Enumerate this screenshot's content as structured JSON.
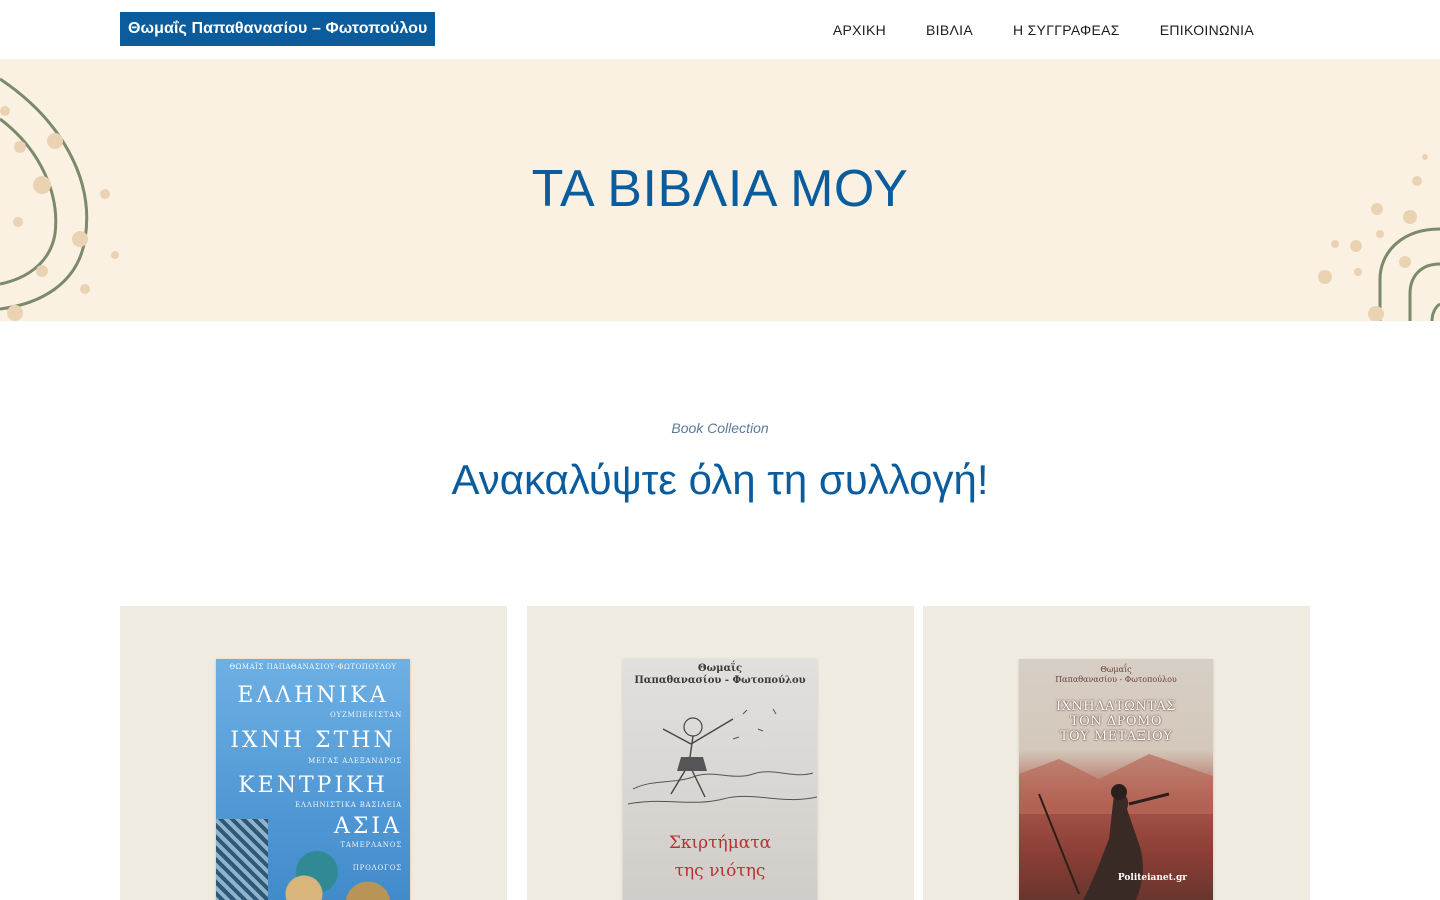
{
  "header": {
    "logo_text": "Θωμαΐς Παπαθανασίου – Φωτοπούλου",
    "nav": [
      {
        "label": "ΑΡΧΙΚΗ"
      },
      {
        "label": "ΒΙΒΛΙΑ"
      },
      {
        "label": "Η ΣΥΓΓΡΑΦΕΑΣ"
      },
      {
        "label": "ΕΠΙΚΟΙΝΩΝΙΑ"
      }
    ]
  },
  "hero": {
    "title": "ΤΑ ΒΙΒΛΙΑ ΜΟΥ"
  },
  "intro": {
    "tag": "Book Collection",
    "heading": "Ανακαλύψτε όλη τη συλλογή!"
  },
  "books": [
    {
      "cover_author": "ΘΩΜΑΪΣ ΠΑΠΑΘΑΝΑΣΙΟΥ-ΦΩΤΟΠΟΥΛΟΥ",
      "title_lines": [
        "ΕΛΛΗΝΙΚΑ",
        "ΙΧΝΗ ΣΤΗΝ",
        "ΚΕΝΤΡΙΚΗ",
        "ΑΣΙΑ"
      ],
      "subtitles": [
        "ΟΥΖΜΠΕΚΙΣΤΑΝ",
        "ΜΕΓΑΣ ΑΛΕΞΑΝΔΡΟΣ",
        "ΕΛΛΗΝΙΣΤΙΚΑ ΒΑΣΙΛΕΙΑ",
        "ΤΑΜΕΡΛΑΝΟΣ"
      ],
      "foreword": "ΠΡΟΛΟΓΟΣ"
    },
    {
      "cover_author": [
        "Θωμαΐς",
        "Παπαθανασίου - Φωτοπούλου"
      ],
      "title_lines": [
        "Σκιρτήματα",
        "της νιότης"
      ]
    },
    {
      "cover_author": [
        "Θωμαΐς",
        "Παπαθανασίου - Φωτοπούλου"
      ],
      "title_lines": [
        "ΙΧΝΗΛΑΤΩΝΤΑΣ",
        "ΤΟΝ ΔΡΟΜΟ",
        "ΤΟΥ ΜΕΤΑΞΙΟΥ"
      ],
      "publisher": "Politeianet.gr"
    }
  ],
  "colors": {
    "brand_blue": "#0b5c9c",
    "hero_bg": "#faf1e2",
    "card_bg": "#efebe0",
    "deco_green": "#7a8a6a",
    "deco_dot": "#ead3b2"
  }
}
